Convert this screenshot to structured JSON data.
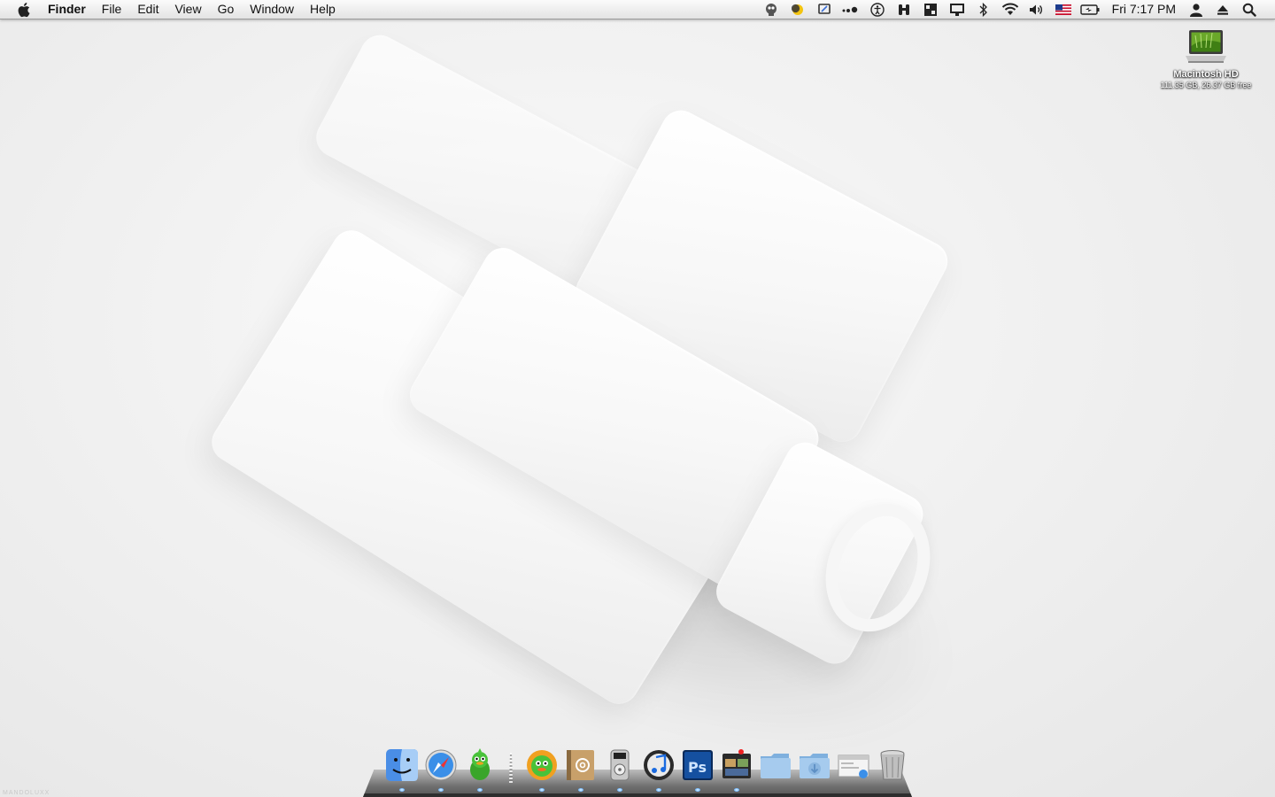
{
  "menubar": {
    "apple_icon": "apple-logo-icon",
    "items": [
      {
        "label": "Finder"
      },
      {
        "label": "File"
      },
      {
        "label": "Edit"
      },
      {
        "label": "View"
      },
      {
        "label": "Go"
      },
      {
        "label": "Window"
      },
      {
        "label": "Help"
      }
    ],
    "status_icons": [
      "robot-icon",
      "moon-icon",
      "scanner-icon",
      "dots-icon",
      "accessibility-icon",
      "binoculars-icon",
      "spaces-icon",
      "display-icon",
      "bluetooth-icon",
      "wifi-icon",
      "volume-icon",
      "us-flag-icon",
      "battery-icon"
    ],
    "clock": "Fri 7:17 PM",
    "user_icon": "user-icon",
    "eject_icon": "eject-icon",
    "spotlight_icon": "spotlight-icon"
  },
  "desktop": {
    "hd_name": "Macintosh HD",
    "hd_info": "111.35 GB, 26.37 GB free"
  },
  "dock": {
    "items": [
      {
        "name": "finder-icon",
        "running": true
      },
      {
        "name": "safari-icon",
        "running": true
      },
      {
        "name": "adium-icon",
        "running": true
      },
      {
        "name": "separator"
      },
      {
        "name": "adium-duck-icon",
        "running": true
      },
      {
        "name": "address-book-icon",
        "running": true
      },
      {
        "name": "dvd-player-icon",
        "running": true
      },
      {
        "name": "itunes-icon",
        "running": true
      },
      {
        "name": "photoshop-icon",
        "running": true
      },
      {
        "name": "photo-booth-icon",
        "running": true
      },
      {
        "name": "folder-icon"
      },
      {
        "name": "downloads-folder-icon"
      },
      {
        "name": "preview-window-icon"
      },
      {
        "name": "trash-icon"
      }
    ]
  },
  "watermark": "MANDOLUXX"
}
